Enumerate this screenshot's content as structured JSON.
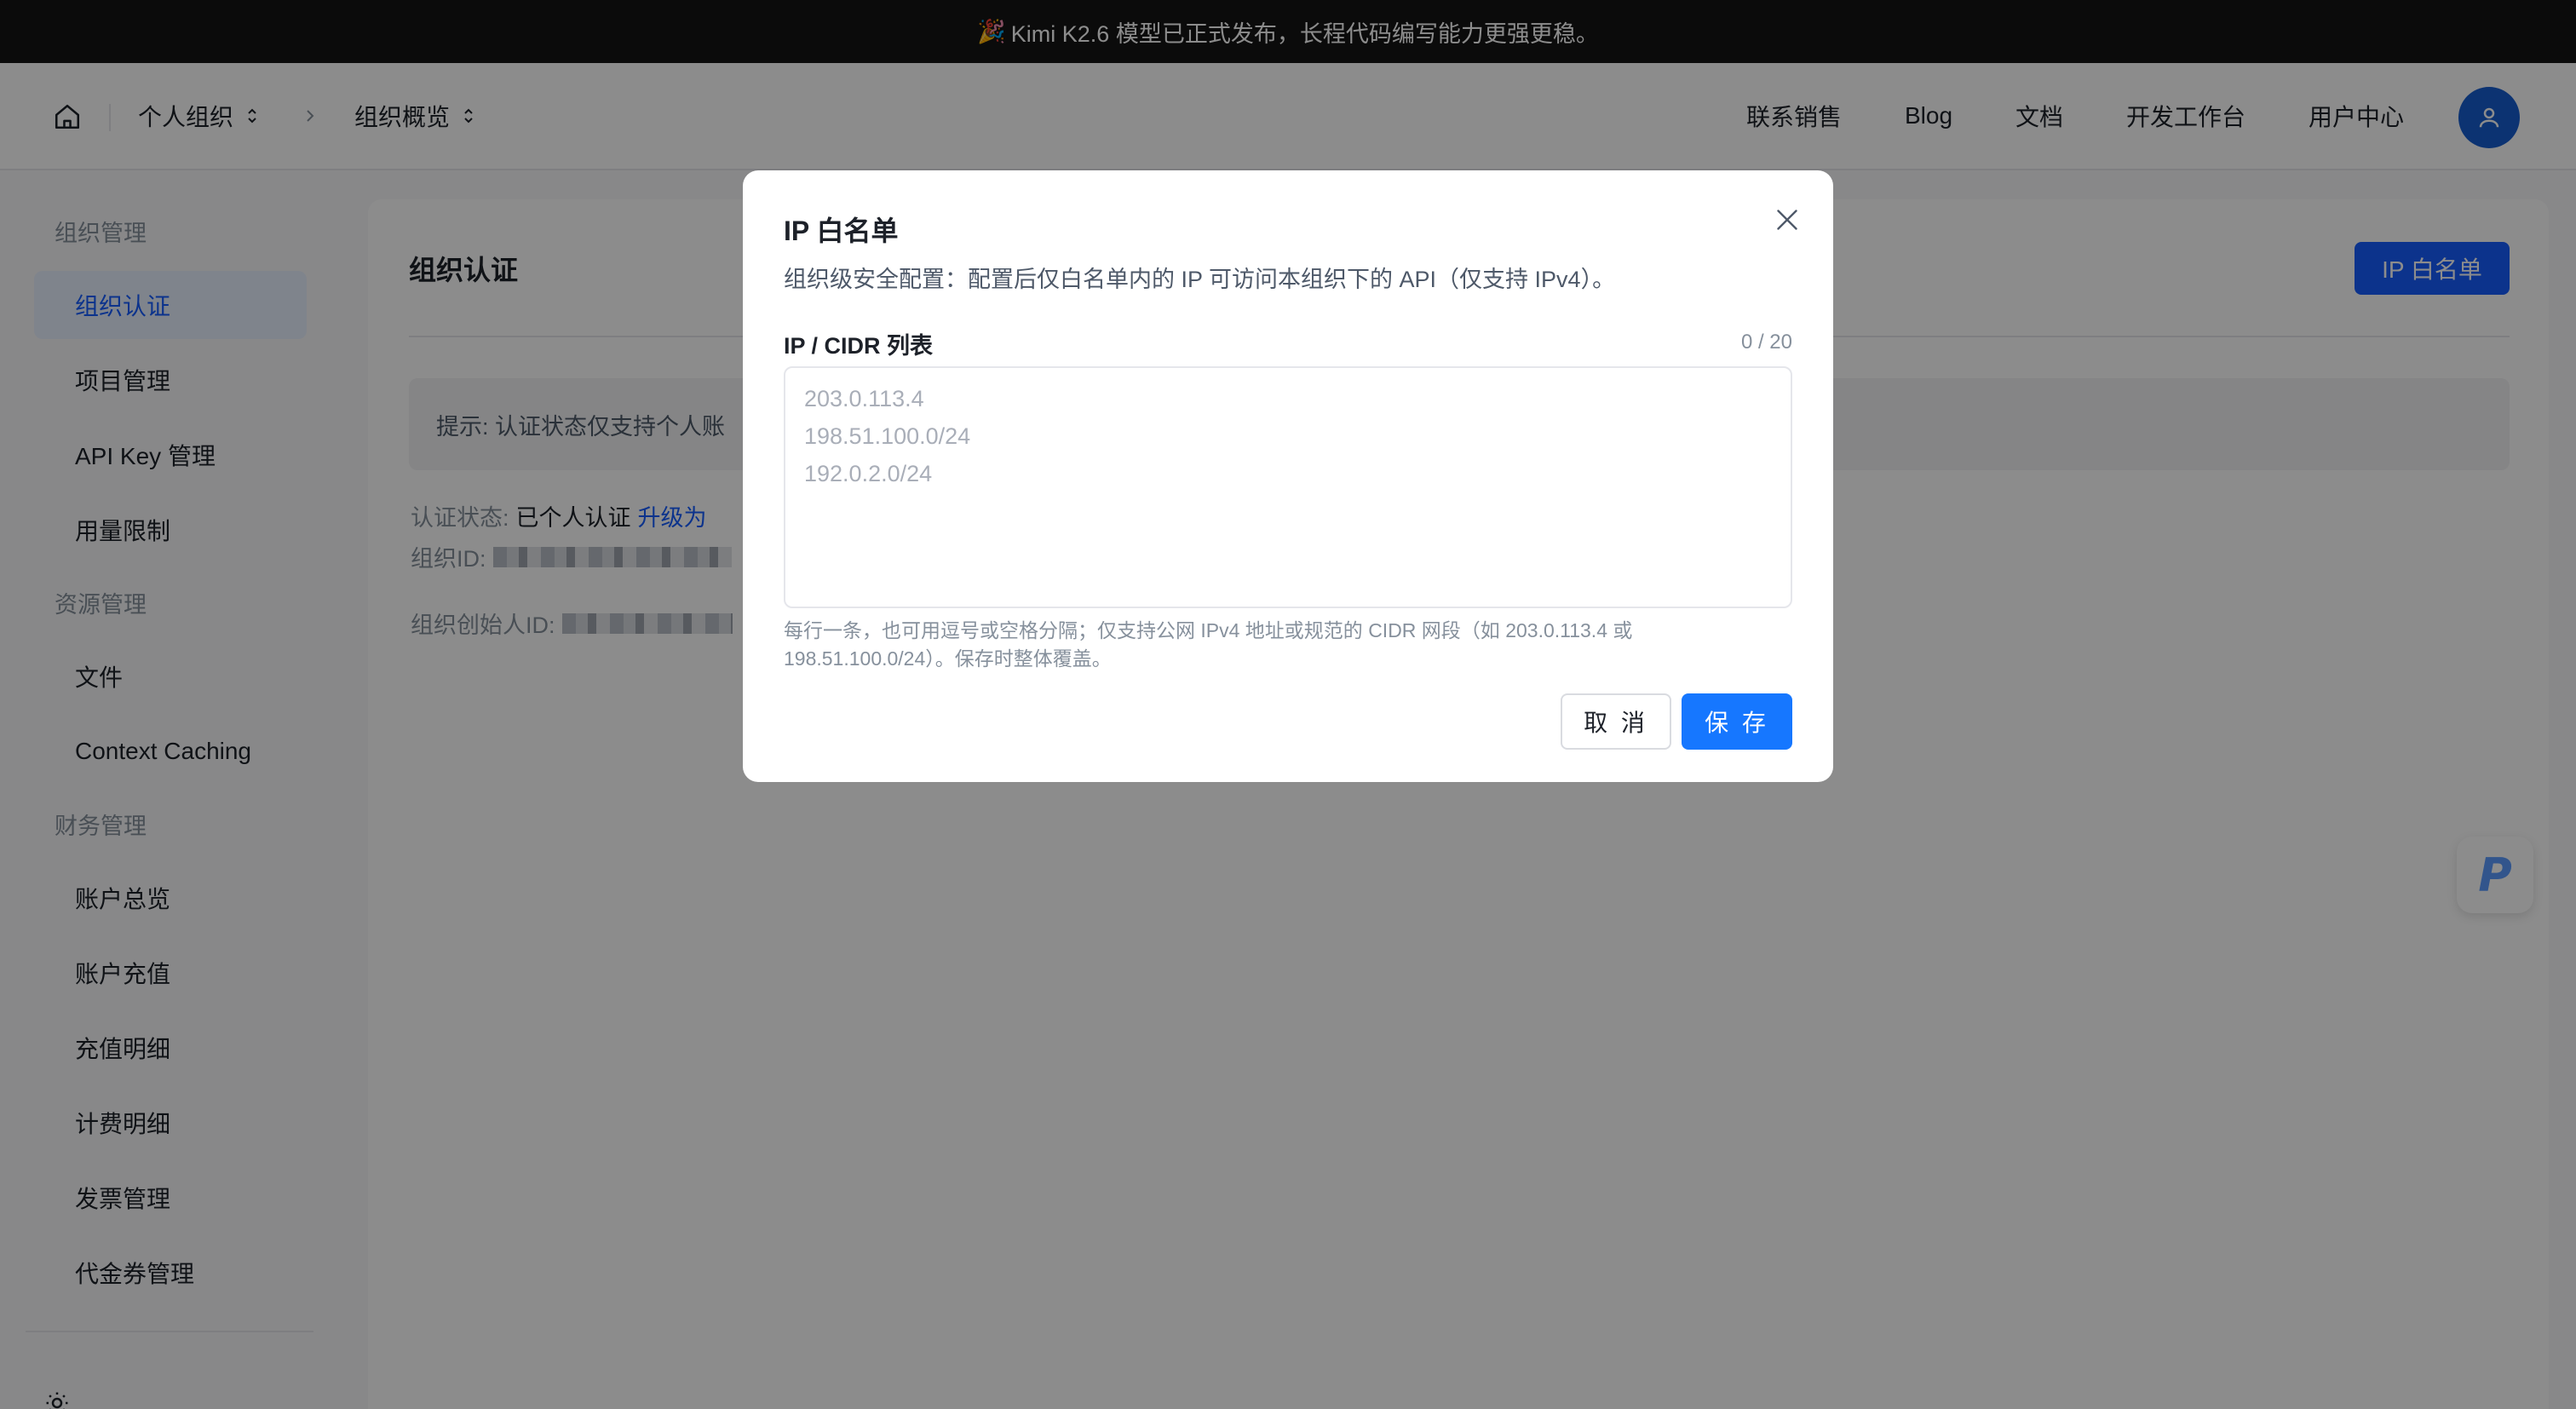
{
  "announcement": {
    "emoji": "🎉",
    "text": "Kimi K2.6 模型已正式发布，长程代码编写能力更强更稳。"
  },
  "header": {
    "org_selector": "个人组织",
    "page_selector": "组织概览",
    "nav": [
      "联系销售",
      "Blog",
      "文档",
      "开发工作台",
      "用户中心"
    ]
  },
  "sidebar": {
    "groups": [
      {
        "label": "组织管理",
        "items": [
          "组织认证",
          "项目管理",
          "API Key 管理",
          "用量限制"
        ]
      },
      {
        "label": "资源管理",
        "items": [
          "文件",
          "Context Caching"
        ]
      },
      {
        "label": "财务管理",
        "items": [
          "账户总览",
          "账户充值",
          "充值明细",
          "计费明细",
          "发票管理",
          "代金券管理"
        ]
      }
    ],
    "active_item": "组织认证"
  },
  "main": {
    "title": "组织认证",
    "ip_whitelist_button": "IP 白名单",
    "tip": "提示: 认证状态仅支持个人账",
    "status_label": "认证状态:",
    "status_value": "已个人认证",
    "upgrade_link": "升级为",
    "org_id_label": "组织ID:",
    "creator_id_label": "组织创始人ID:"
  },
  "modal": {
    "title": "IP 白名单",
    "description": "组织级安全配置：配置后仅白名单内的 IP 可访问本组织下的 API（仅支持 IPv4）。",
    "field_label": "IP / CIDR 列表",
    "count": "0 / 20",
    "placeholder": "203.0.113.4\n198.51.100.0/24\n192.0.2.0/24",
    "help": "每行一条，也可用逗号或空格分隔；仅支持公网 IPv4 地址或规范的 CIDR 网段（如 203.0.113.4 或 198.51.100.0/24）。保存时整体覆盖。",
    "cancel_label": "取 消",
    "save_label": "保 存"
  },
  "float_widget": {
    "letter": "P"
  },
  "colors": {
    "primary": "#165dff",
    "announcement_bg": "#141414",
    "active_bg": "#e8f0ff"
  }
}
